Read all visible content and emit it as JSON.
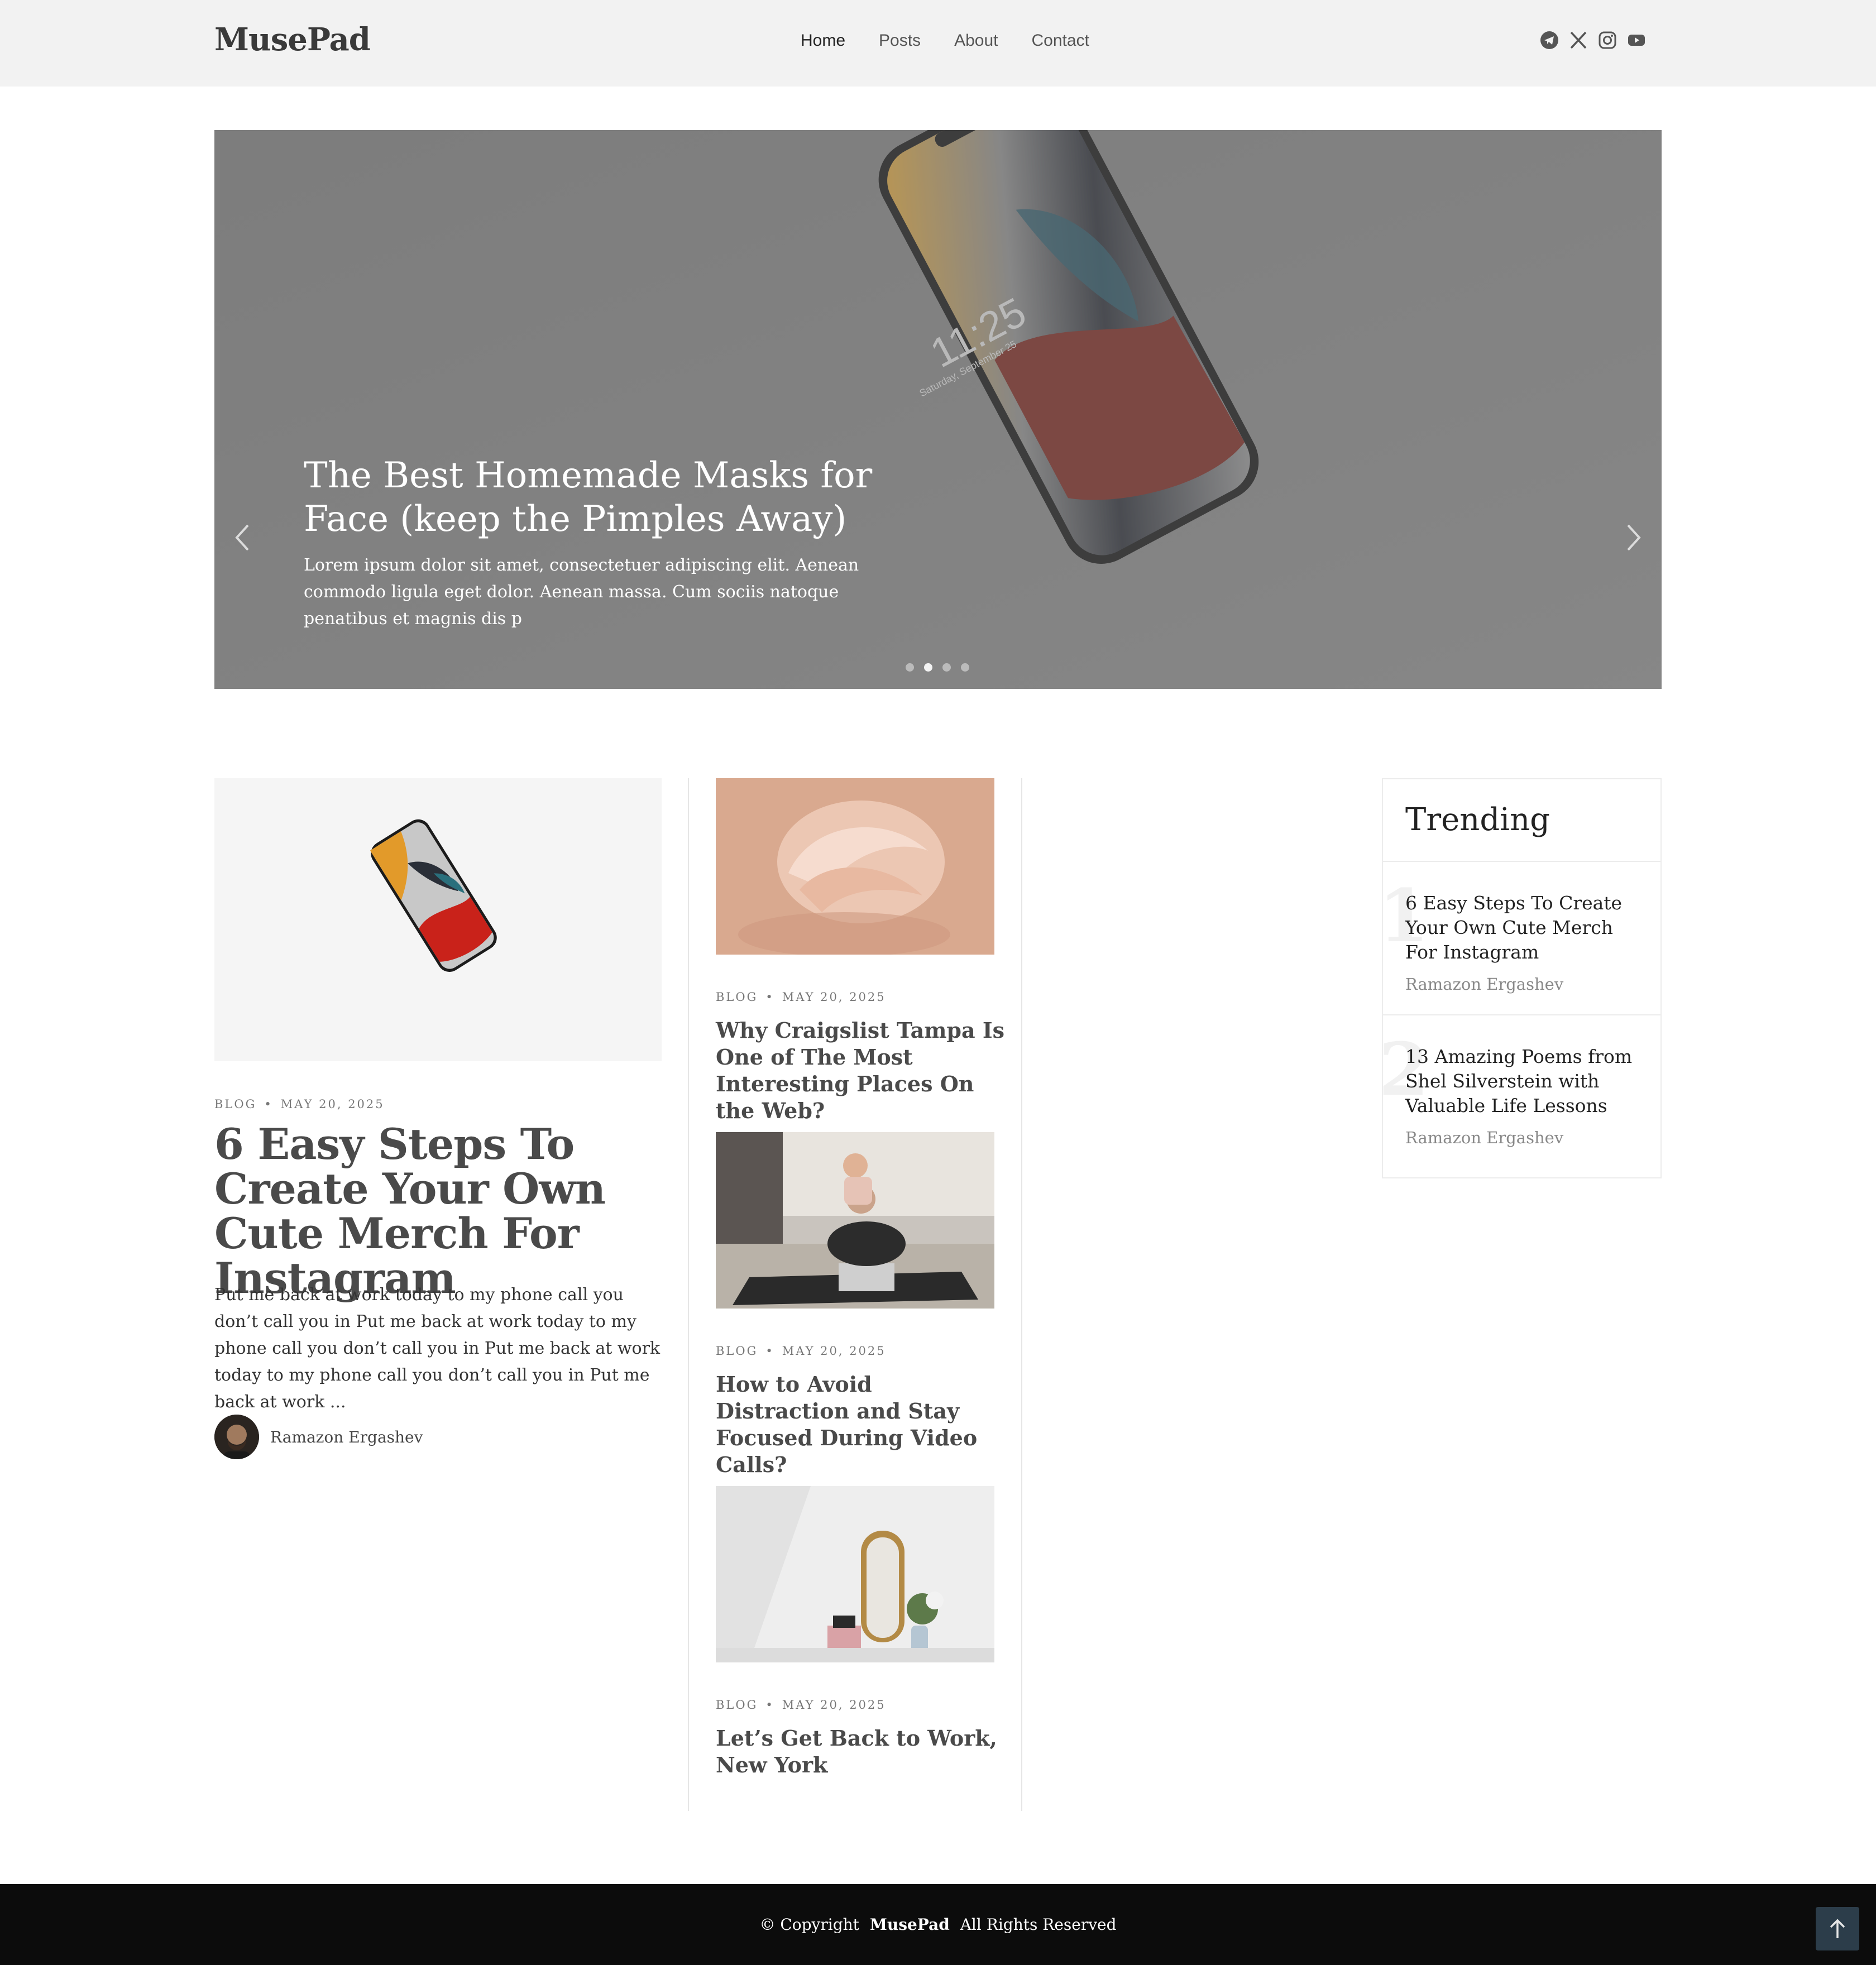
{
  "brand": {
    "logo": "MusePad"
  },
  "nav": {
    "items": [
      {
        "label": "Home",
        "active": true
      },
      {
        "label": "Posts"
      },
      {
        "label": "About"
      },
      {
        "label": "Contact"
      }
    ]
  },
  "social": [
    "telegram-icon",
    "x-icon",
    "instagram-icon",
    "youtube-icon"
  ],
  "hero": {
    "title": "The Best Homemade Masks for Face (keep the Pimples Away)",
    "description": "Lorem ipsum dolor sit amet, consectetuer adipiscing elit. Aenean commodo ligula eget dolor. Aenean massa. Cum sociis natoque penatibus et magnis dis p",
    "phone_time": "11:25",
    "phone_date": "Saturday, September 25",
    "slides": 4,
    "active_slide": 2
  },
  "featured": {
    "category": "BLOG",
    "date": "MAY 20, 2025",
    "title": "6 Easy Steps To Create Your Own Cute Merch For Instagram",
    "excerpt": "Put me back at work today to my phone call you don’t call you in Put me back at work today to my phone call you don’t call you in Put me back at work today to my phone call you don’t call you in Put me back at work ...",
    "author": "Ramazon Ergashev"
  },
  "posts": [
    {
      "category": "BLOG",
      "date": "MAY 20, 2025",
      "title": "Why Craigslist Tampa Is One of The Most Interesting Places On the Web?"
    },
    {
      "category": "BLOG",
      "date": "MAY 20, 2025",
      "title": "How to Avoid Distraction and Stay Focused During Video Calls?"
    },
    {
      "category": "BLOG",
      "date": "MAY 20, 2025",
      "title": "Let’s Get Back to Work, New York"
    }
  ],
  "trending": {
    "heading": "Trending",
    "items": [
      {
        "num": "1",
        "title": "6 Easy Steps To Create Your Own Cute Merch For Instagram",
        "author": "Ramazon Ergashev"
      },
      {
        "num": "2",
        "title": "13 Amazing Poems from Shel Silverstein with Valuable Life Lessons",
        "author": "Ramazon Ergashev"
      }
    ]
  },
  "footer": {
    "prefix": "© Copyright",
    "brand": "MusePad",
    "suffix": "All Rights Reserved"
  },
  "colors": {
    "header_bg": "#f2f2f2",
    "hero_overlay": "#838383",
    "footer_bg": "#0c0c0c",
    "to_top_bg": "#2c3d4a"
  }
}
